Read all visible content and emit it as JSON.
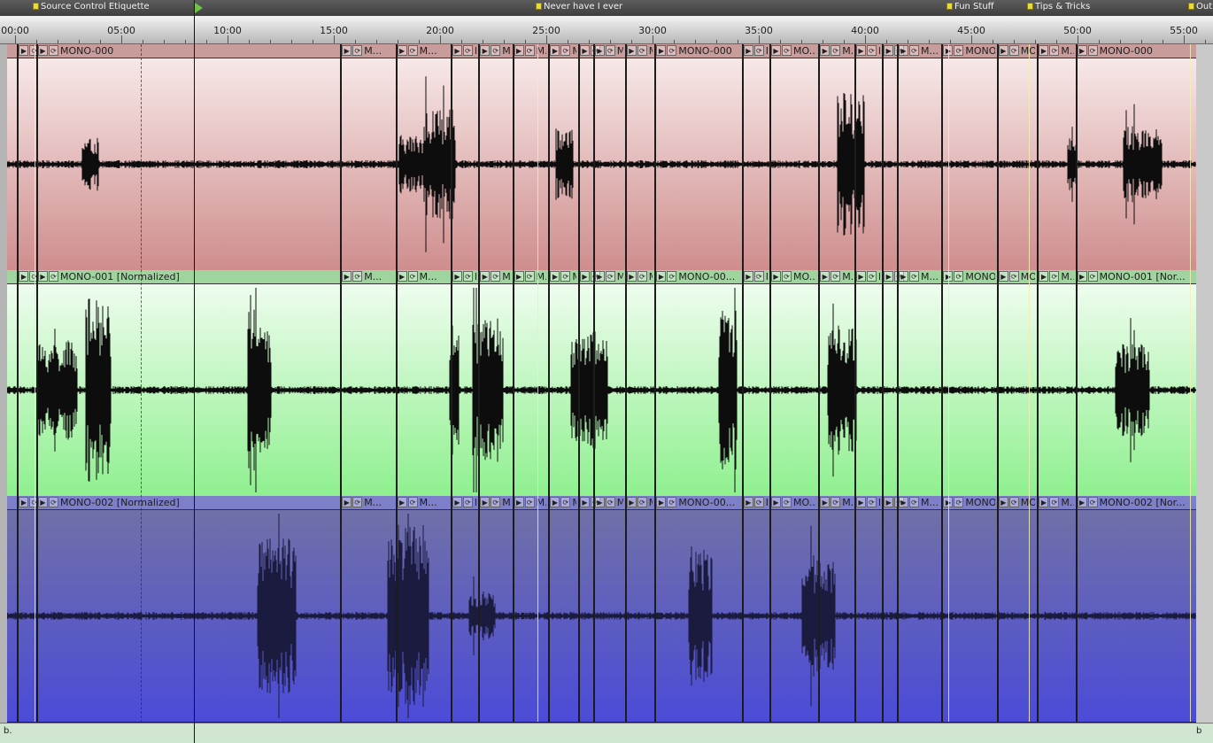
{
  "markers": [
    {
      "label": "Source Control Etiquette",
      "time_min": 0.9
    },
    {
      "label": "Never have I ever",
      "time_min": 24.6
    },
    {
      "label": "Fun Stuff",
      "time_min": 43.9
    },
    {
      "label": "Tips & Tricks",
      "time_min": 47.7
    },
    {
      "label": "Outro",
      "time_min": 55.3
    }
  ],
  "ruler": {
    "labels": [
      "00:00",
      "05:00",
      "10:00",
      "15:00",
      "20:00",
      "25:00",
      "30:00",
      "35:00",
      "40:00",
      "45:00",
      "50:00",
      "55:00"
    ]
  },
  "playhead_min": 8.4,
  "cursor_min": 5.9,
  "tracks": [
    {
      "name": "MONO-000",
      "header_color": "#c99c9c",
      "bg_top": "#f7e8e8",
      "bg_bottom": "#cf8d8d",
      "wave_color": "#0d0d0d",
      "clips": [
        {
          "start_min": 0.1,
          "label": "M"
        },
        {
          "start_min": 1.0,
          "label": "MONO-000"
        },
        {
          "start_min": 15.3,
          "label": "M..."
        },
        {
          "start_min": 17.9,
          "label": "M..."
        },
        {
          "start_min": 20.5,
          "label": "M..."
        },
        {
          "start_min": 21.8,
          "label": "M..."
        },
        {
          "start_min": 23.4,
          "label": "M..."
        },
        {
          "start_min": 25.1,
          "label": "M..."
        },
        {
          "start_min": 26.5,
          "label": "M"
        },
        {
          "start_min": 27.2,
          "label": "M..."
        },
        {
          "start_min": 28.7,
          "label": "M..."
        },
        {
          "start_min": 30.1,
          "label": "MONO-000"
        },
        {
          "start_min": 34.2,
          "label": "M"
        },
        {
          "start_min": 35.5,
          "label": "MO..."
        },
        {
          "start_min": 37.8,
          "label": "M..."
        },
        {
          "start_min": 39.5,
          "label": "M..."
        },
        {
          "start_min": 40.8,
          "label": "M"
        },
        {
          "start_min": 41.5,
          "label": "M..."
        },
        {
          "start_min": 43.6,
          "label": "MONO-..."
        },
        {
          "start_min": 46.2,
          "label": "MO..."
        },
        {
          "start_min": 48.1,
          "label": "M..."
        },
        {
          "start_min": 49.9,
          "label": "MONO-000"
        }
      ]
    },
    {
      "name": "MONO-001 [Normalized]",
      "header_color": "#9fd49f",
      "bg_top": "#eefcee",
      "bg_bottom": "#8ff08f",
      "wave_color": "#0d0d0d",
      "clips": [
        {
          "start_min": 0.1,
          "label": "M"
        },
        {
          "start_min": 1.0,
          "label": "MONO-001 [Normalized]"
        },
        {
          "start_min": 15.3,
          "label": "M..."
        },
        {
          "start_min": 17.9,
          "label": "M..."
        },
        {
          "start_min": 20.5,
          "label": "M..."
        },
        {
          "start_min": 21.8,
          "label": "M..."
        },
        {
          "start_min": 23.4,
          "label": "M..."
        },
        {
          "start_min": 25.1,
          "label": "M..."
        },
        {
          "start_min": 26.5,
          "label": "M"
        },
        {
          "start_min": 27.2,
          "label": "M..."
        },
        {
          "start_min": 28.7,
          "label": "M..."
        },
        {
          "start_min": 30.1,
          "label": "MONO-00..."
        },
        {
          "start_min": 34.2,
          "label": "M"
        },
        {
          "start_min": 35.5,
          "label": "MO..."
        },
        {
          "start_min": 37.8,
          "label": "M..."
        },
        {
          "start_min": 39.5,
          "label": "M..."
        },
        {
          "start_min": 40.8,
          "label": "M"
        },
        {
          "start_min": 41.5,
          "label": "M..."
        },
        {
          "start_min": 43.6,
          "label": "MONO-..."
        },
        {
          "start_min": 46.2,
          "label": "MO..."
        },
        {
          "start_min": 48.1,
          "label": "M..."
        },
        {
          "start_min": 49.9,
          "label": "MONO-001 [Nor..."
        }
      ]
    },
    {
      "name": "MONO-002 [Normalized]",
      "header_color": "#7d7fc8",
      "bg_top": "#7070a8",
      "bg_bottom": "#4b4bd8",
      "wave_color": "#1b1b40",
      "clips": [
        {
          "start_min": 0.1,
          "label": "M"
        },
        {
          "start_min": 1.0,
          "label": "MONO-002 [Normalized]"
        },
        {
          "start_min": 15.3,
          "label": "M..."
        },
        {
          "start_min": 17.9,
          "label": "M..."
        },
        {
          "start_min": 20.5,
          "label": "M..."
        },
        {
          "start_min": 21.8,
          "label": "M..."
        },
        {
          "start_min": 23.4,
          "label": "M..."
        },
        {
          "start_min": 25.1,
          "label": "M..."
        },
        {
          "start_min": 26.5,
          "label": "M"
        },
        {
          "start_min": 27.2,
          "label": "M..."
        },
        {
          "start_min": 28.7,
          "label": "M..."
        },
        {
          "start_min": 30.1,
          "label": "MONO-00..."
        },
        {
          "start_min": 34.2,
          "label": "M"
        },
        {
          "start_min": 35.5,
          "label": "MO..."
        },
        {
          "start_min": 37.8,
          "label": "M..."
        },
        {
          "start_min": 39.5,
          "label": "M..."
        },
        {
          "start_min": 40.8,
          "label": "M"
        },
        {
          "start_min": 41.5,
          "label": "M..."
        },
        {
          "start_min": 43.6,
          "label": "MONO-..."
        },
        {
          "start_min": 46.2,
          "label": "MO..."
        },
        {
          "start_min": 48.1,
          "label": "M..."
        },
        {
          "start_min": 49.9,
          "label": "MONO-002 [Nor..."
        }
      ]
    }
  ],
  "bottom_bar": {
    "left_label": "b.",
    "right_label": "b"
  }
}
